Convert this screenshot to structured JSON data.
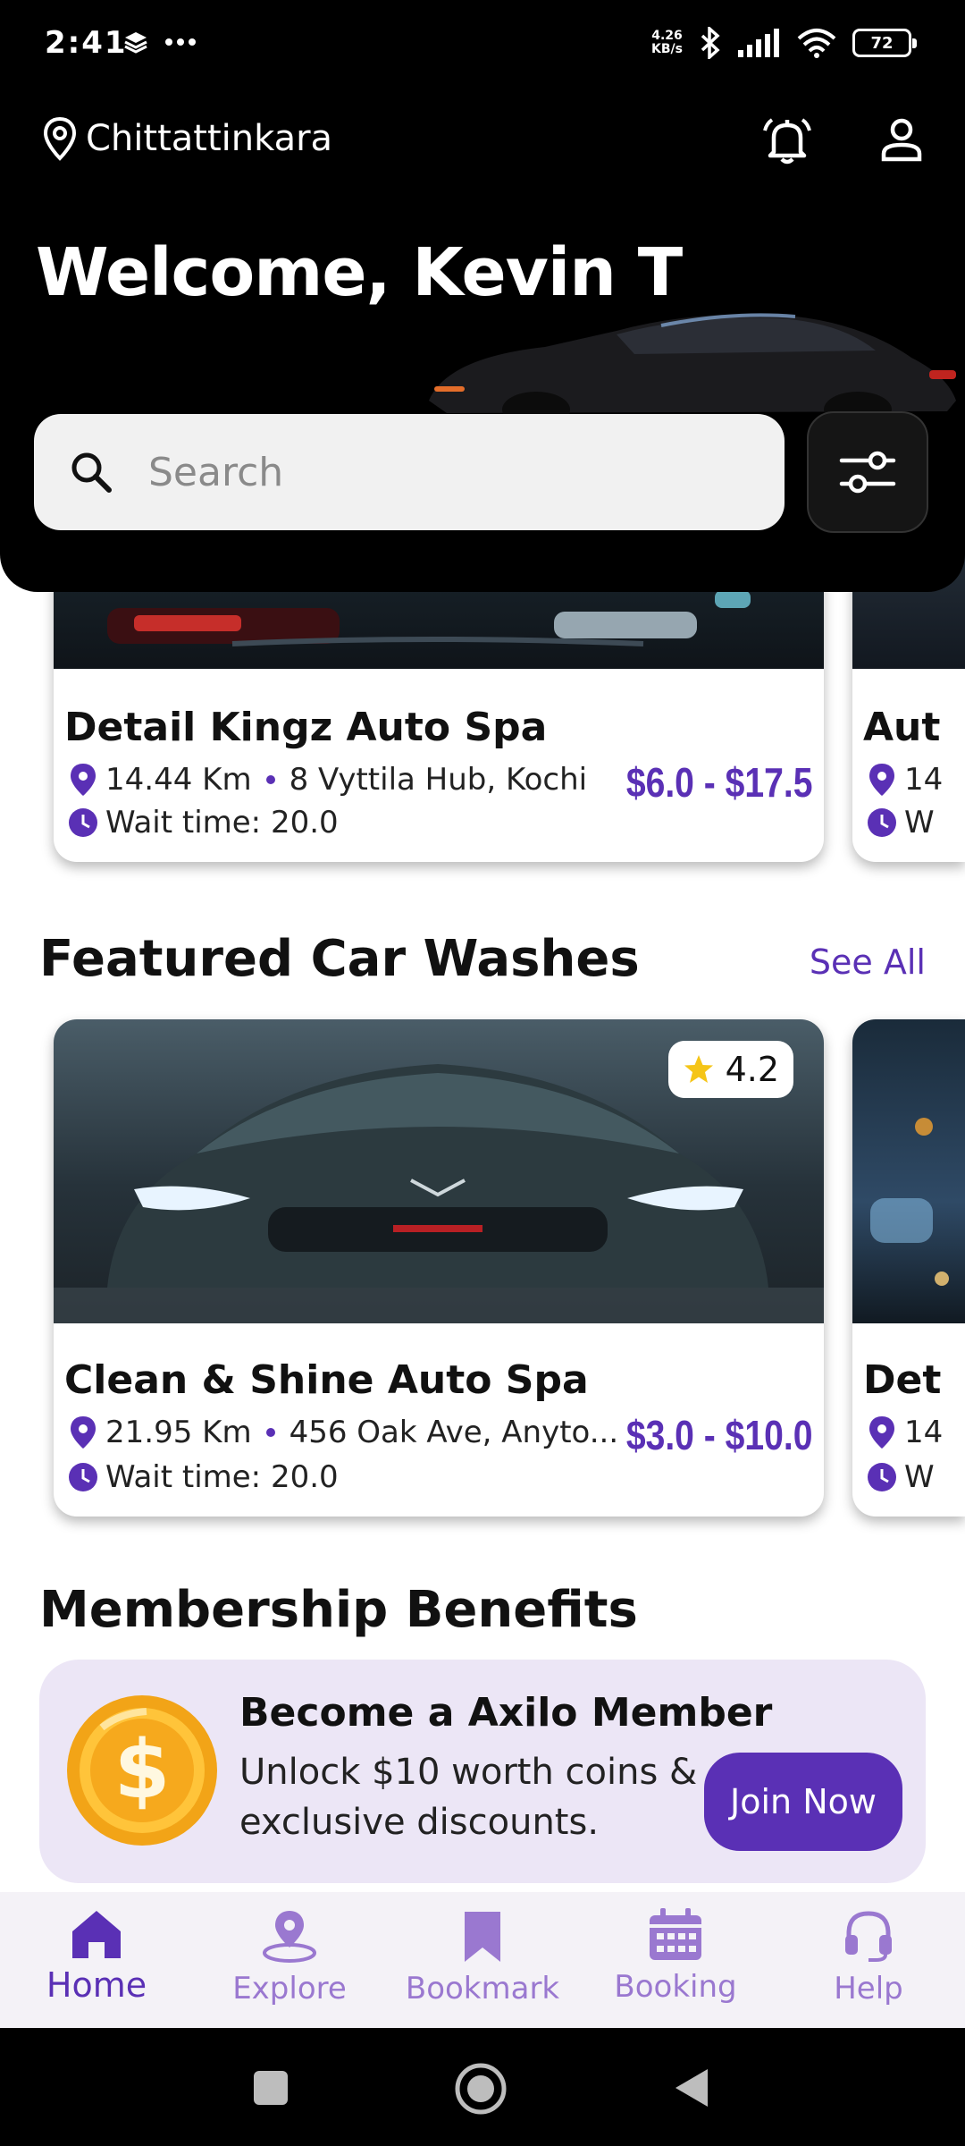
{
  "status_bar": {
    "time": "2:41",
    "net_speed_value": "4.26",
    "net_speed_unit": "KB/s",
    "battery": "72"
  },
  "header": {
    "location": "Chittattinkara",
    "welcome": "Welcome, Kevin T"
  },
  "search": {
    "placeholder": "Search"
  },
  "nearby_cards": [
    {
      "name": "Detail Kingz Auto Spa",
      "distance": "14.44 Km",
      "address": "8 Vyttila Hub, Kochi",
      "wait": "Wait time: 20.0",
      "price": "$6.0 - $17.5"
    },
    {
      "name": "Aut",
      "distance": "14",
      "wait": "W"
    }
  ],
  "featured": {
    "title": "Featured Car Washes",
    "see_all": "See All",
    "cards": [
      {
        "name": "Clean & Shine Auto Spa",
        "distance": "21.95 Km",
        "address": "456 Oak Ave, Anyto...",
        "wait": "Wait time: 20.0",
        "price": "$3.0 - $10.0",
        "rating": "4.2"
      },
      {
        "name": "Det",
        "distance": "14",
        "wait": "W"
      }
    ]
  },
  "membership": {
    "section_title": "Membership Benefits",
    "title": "Become a Axilo Member",
    "desc": "Unlock $10 worth coins & exclusive discounts.",
    "button": "Join Now"
  },
  "nav": {
    "items": [
      {
        "label": "Home",
        "icon": "home-icon"
      },
      {
        "label": "Explore",
        "icon": "location-pin-icon"
      },
      {
        "label": "Bookmark",
        "icon": "bookmark-icon"
      },
      {
        "label": "Booking",
        "icon": "calendar-icon"
      },
      {
        "label": "Help",
        "icon": "headset-icon"
      }
    ],
    "active_index": 0
  },
  "colors": {
    "accent": "#5a30b5",
    "accent_light": "#ece6f6",
    "header_bg": "#000000",
    "star": "#f5c518"
  }
}
